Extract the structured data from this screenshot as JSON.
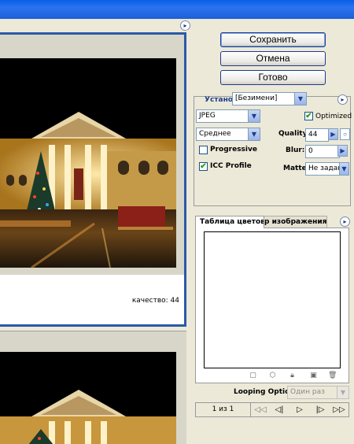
{
  "buttons": {
    "save": "Сохранить",
    "cancel": "Отмена",
    "done": "Готово"
  },
  "preview": {
    "quality_text": "качество: 44"
  },
  "settings": {
    "preset_label": "Установ",
    "preset_value": "[Безимени]",
    "format_value": "JPEG",
    "optimized_label": "Optimized",
    "optimized_checked": true,
    "quality_level_value": "Среднее",
    "quality_label": "Quality:",
    "quality_value": "44",
    "progressive_label": "Progressive",
    "progressive_checked": false,
    "blur_label": "Blur:",
    "blur_value": "0",
    "icc_label": "ICC Profile",
    "icc_checked": true,
    "matte_label": "Matte:",
    "matte_value": "Не задан"
  },
  "color_table": {
    "tab_active": "Таблица цветов",
    "tab_inactive": "р изображения"
  },
  "animation": {
    "looping_label": "Looping Options:",
    "looping_value": "Один раз",
    "frame_counter": "1 из 1"
  },
  "icons": {
    "first": "⏮",
    "prev": "◁",
    "play": "▷",
    "next": "▷",
    "last": "⏭"
  },
  "colors": {
    "titlebar": "#0a5ee8",
    "active_border": "#2a5aa8",
    "panel_bg": "#ece9d8"
  }
}
